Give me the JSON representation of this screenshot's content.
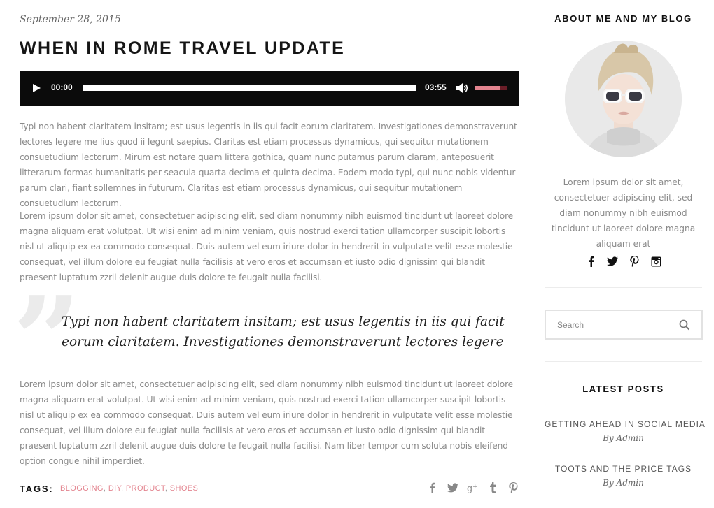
{
  "post": {
    "date": "September 28, 2015",
    "title": "WHEN IN ROME TRAVEL UPDATE",
    "audio": {
      "current_time": "00:00",
      "duration": "03:55",
      "progress": 0,
      "volume": 0.8,
      "volume_color": "#e3848f"
    },
    "paragraphs": [
      "Typi non habent claritatem insitam; est usus legentis in iis qui facit eorum claritatem. Investigationes demonstraverunt lectores legere me lius quod ii legunt saepius. Claritas est etiam processus dynamicus, qui sequitur mutationem consuetudium lectorum. Mirum est notare quam littera gothica, quam nunc putamus parum claram, anteposuerit litterarum formas humanitatis per seacula quarta decima et quinta decima. Eodem modo typi, qui nunc nobis videntur parum clari, fiant sollemnes in futurum. Claritas est etiam processus dynamicus, qui sequitur mutationem consuetudium lectorum.",
      "Lorem ipsum dolor sit amet, consectetuer adipiscing elit, sed diam nonummy nibh euismod tincidunt ut laoreet dolore magna aliquam erat volutpat. Ut wisi enim ad minim veniam, quis nostrud exerci tation ullamcorper suscipit lobortis nisl ut aliquip ex ea commodo consequat. Duis autem vel eum iriure dolor in hendrerit in vulputate velit esse molestie consequat, vel illum dolore eu feugiat nulla facilisis at vero eros et accumsan et iusto odio dignissim qui blandit praesent luptatum zzril delenit augue duis dolore te feugait nulla facilisi.",
      "Lorem ipsum dolor sit amet, consectetuer adipiscing elit, sed diam nonummy nibh euismod tincidunt ut laoreet dolore magna aliquam erat volutpat. Ut wisi enim ad minim veniam, quis nostrud exerci tation ullamcorper suscipit lobortis nisl ut aliquip ex ea commodo consequat. Duis autem vel eum iriure dolor in hendrerit in vulputate velit esse molestie consequat, vel illum dolore eu feugiat nulla facilisis at vero eros et accumsan et iusto odio dignissim qui blandit praesent luptatum zzril delenit augue duis dolore te feugait nulla facilisi. Nam liber tempor cum soluta nobis eleifend option congue nihil imperdiet."
    ],
    "quote_mark": "”",
    "quote": "Typi non habent claritatem insitam; est usus legentis in iis qui facit eorum claritatem. Investigationes demonstraverunt lectores legere",
    "tags_label": "TAGS:",
    "tags": [
      "BLOGGING",
      "DIY",
      "PRODUCT",
      "SHOES"
    ],
    "tag_separator": ", ",
    "tag_color": "#e3848f",
    "share_icons": [
      "facebook-icon",
      "twitter-icon",
      "google-plus-icon",
      "tumblr-icon",
      "pinterest-icon"
    ]
  },
  "sidebar": {
    "about_title": "ABOUT ME AND MY BLOG",
    "about_text": "Lorem ipsum dolor sit amet, consectetuer adipiscing elit, sed diam nonummy nibh euismod tincidunt ut laoreet dolore magna aliquam erat",
    "social_icons": [
      "facebook-icon",
      "twitter-icon",
      "pinterest-icon",
      "instagram-icon"
    ],
    "search_placeholder": "Search",
    "latest_title": "LATEST POSTS",
    "latest_posts": [
      {
        "title": "GETTING AHEAD IN SOCIAL MEDIA",
        "byline": "By Admin"
      },
      {
        "title": "TOOTS AND THE PRICE TAGS",
        "byline": "By Admin"
      }
    ]
  }
}
